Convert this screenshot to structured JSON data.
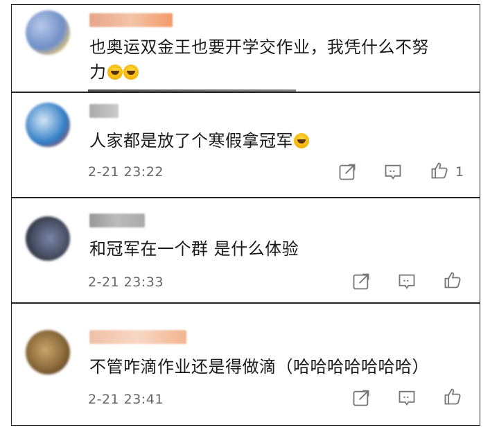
{
  "comments": [
    {
      "username": "",
      "text": "也奥运双金王也要开学交作业，我凭什么不努",
      "text_line2": "力",
      "emoji_count": 2,
      "time": "",
      "likes": "",
      "avatar_colors": [
        "#6f8fc8",
        "#e8c87a",
        "#b9c7e8"
      ]
    },
    {
      "username": "",
      "text": "人家都是放了个寒假拿冠军",
      "emoji_count": 1,
      "time": "2-21 23:22",
      "likes": "1",
      "avatar_colors": [
        "#2e7cc4",
        "#d3e6f5",
        "#c4473a"
      ]
    },
    {
      "username": "",
      "text": "和冠军在一个群 是什么体验",
      "emoji_count": 0,
      "time": "2-21 23:33",
      "likes": "",
      "avatar_colors": [
        "#2c2f3d",
        "#7a84a8",
        "#4b5368"
      ]
    },
    {
      "username": "",
      "text": "不管咋滴作业还是得做滴（哈哈哈哈哈哈哈）",
      "emoji_count": 0,
      "time": "2-21 23:41",
      "likes": "",
      "avatar_colors": [
        "#8a6a3a",
        "#c9a46b",
        "#5b3f22"
      ]
    }
  ],
  "icons": {
    "share": "share-icon",
    "reply": "reply-icon",
    "like": "thumbs-up-icon"
  },
  "colors": {
    "border": "#222222",
    "meta_text": "#666666",
    "icon": "#777777"
  }
}
